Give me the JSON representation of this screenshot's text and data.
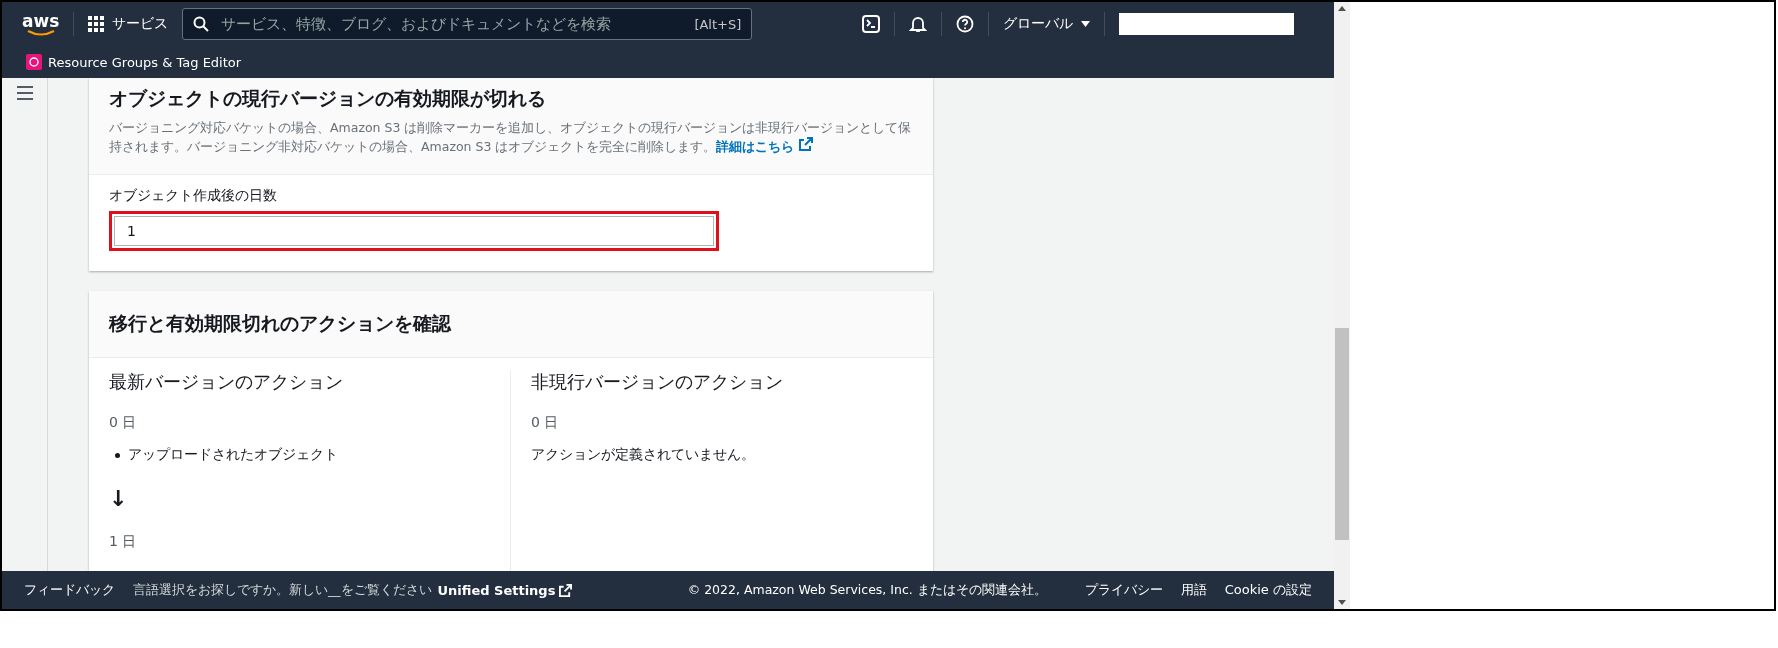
{
  "header": {
    "logo": "aws",
    "services": "サービス",
    "search": {
      "placeholder": "サービス、特徴、ブログ、およびドキュメントなどを検索",
      "shortcut": "[Alt+S]"
    },
    "region": "グローバル"
  },
  "breadcrumb": "Resource Groups & Tag Editor",
  "expiration_panel": {
    "title": "オブジェクトの現行バージョンの有効期限が切れる",
    "description": "バージョニング対応バケットの場合、Amazon S3 は削除マーカーを追加し、オブジェクトの現行バージョンは非現行バージョンとして保持されます。バージョニング非対応バケットの場合、Amazon S3 はオブジェクトを完全に削除します。",
    "link": "詳細はこちら",
    "field_label": "オブジェクト作成後の日数",
    "field_value": "1",
    "highlighted": true
  },
  "review_panel": {
    "title": "移行と有効期限切れのアクションを確認",
    "columns": [
      {
        "heading": "最新バージョンのアクション",
        "items": [
          {
            "kind": "day",
            "text": "0 日"
          },
          {
            "kind": "bullet",
            "text": "アップロードされたオブジェクト"
          },
          {
            "kind": "arrow",
            "text": "↓"
          },
          {
            "kind": "day",
            "text": "1 日"
          }
        ]
      },
      {
        "heading": "非現行バージョンのアクション",
        "items": [
          {
            "kind": "day",
            "text": "0 日"
          },
          {
            "kind": "note",
            "text": "アクションが定義されていません。"
          }
        ]
      }
    ]
  },
  "footer": {
    "feedback": "フィードバック",
    "notice": "言語選択をお探しですか。新しい__をご覧ください",
    "notice_link": "Unified Settings",
    "copyright": "© 2022, Amazon Web Services, Inc. またはその関連会社。",
    "links": [
      "プライバシー",
      "用語",
      "Cookie の設定"
    ]
  }
}
